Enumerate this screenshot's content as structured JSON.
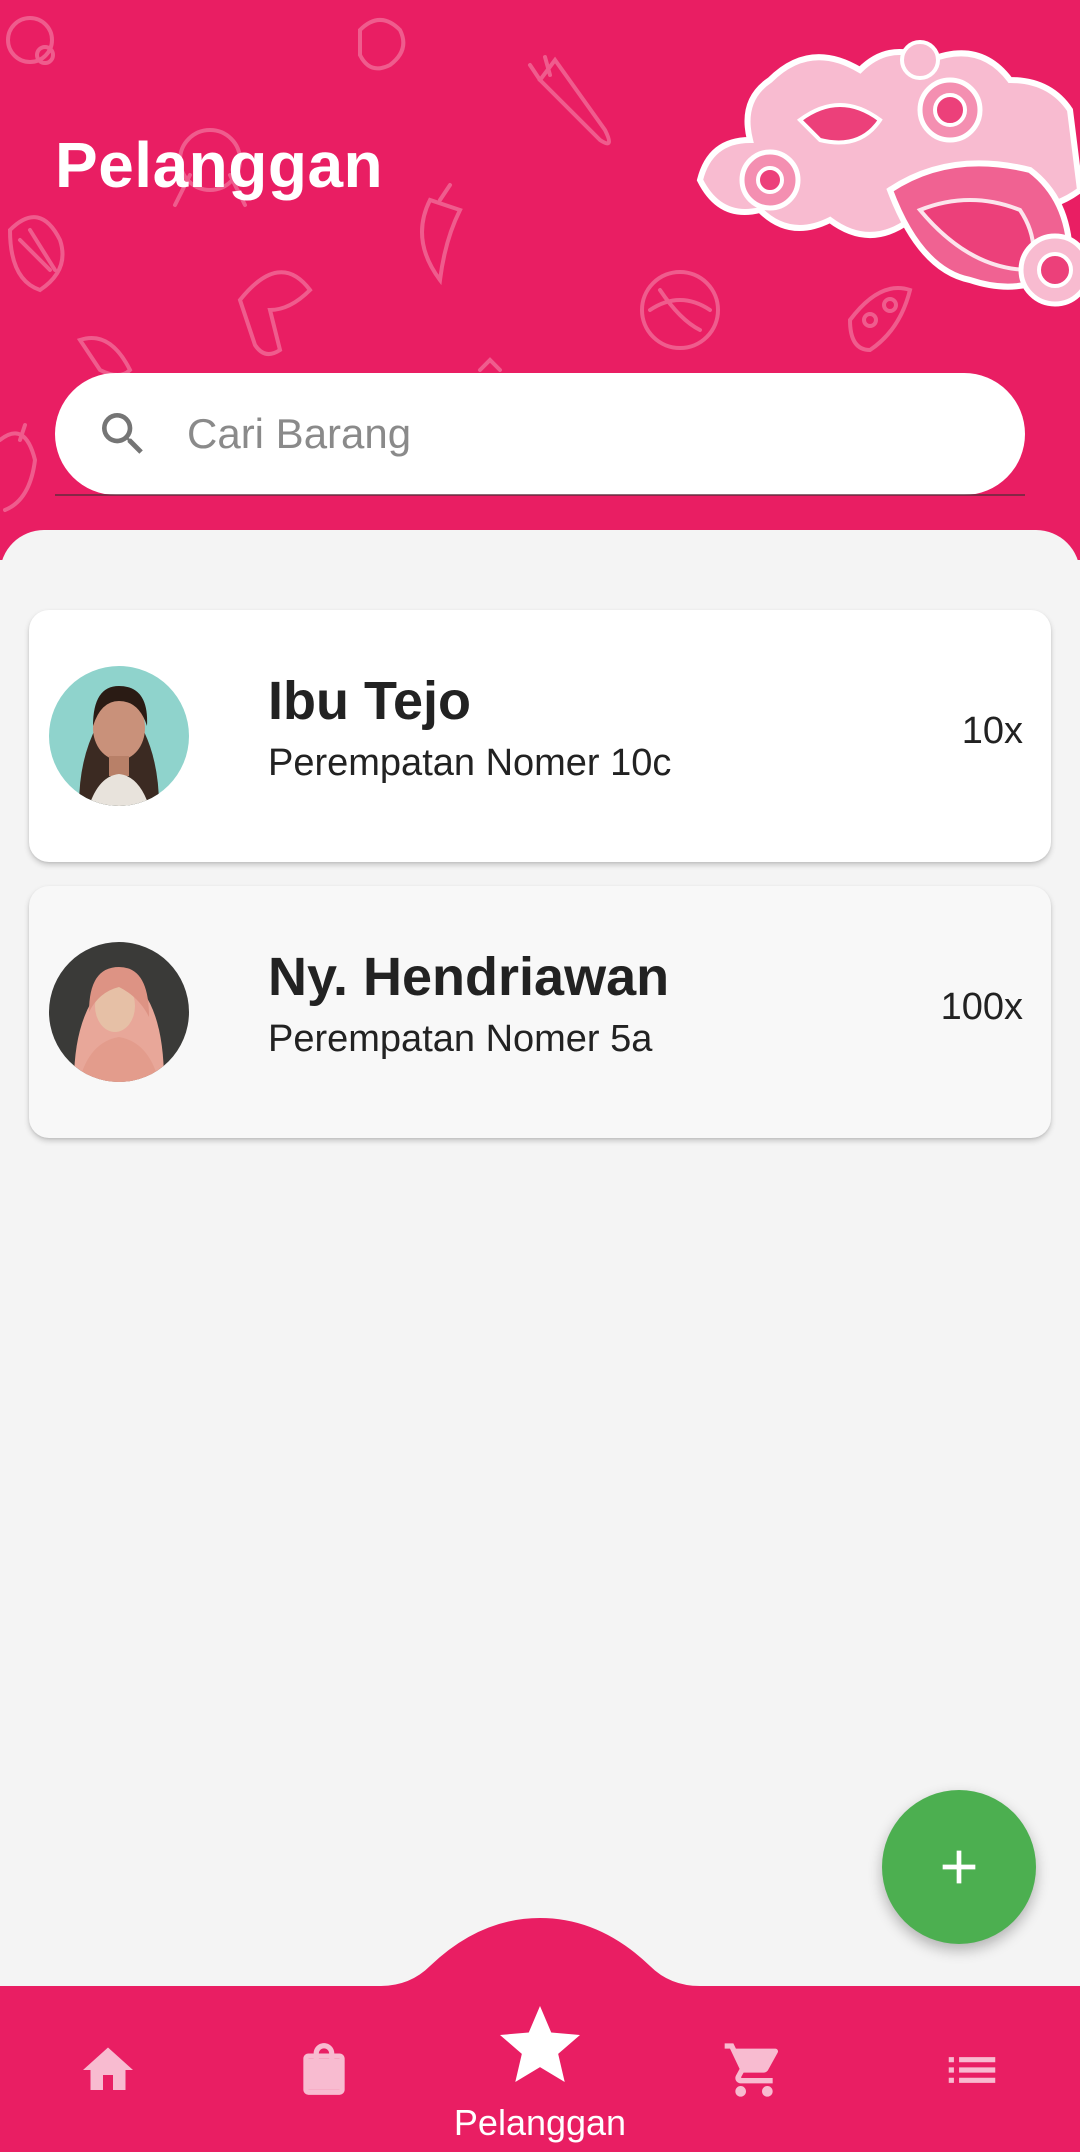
{
  "header": {
    "title": "Pelanggan"
  },
  "search": {
    "placeholder": "Cari Barang",
    "icon": "search-icon"
  },
  "customers": [
    {
      "name": "Ibu Tejo",
      "address": "Perempatan Nomer 10c",
      "count": "10x",
      "avatar": "avatar-photo"
    },
    {
      "name": "Ny. Hendriawan",
      "address": "Perempatan Nomer 5a",
      "count": "100x",
      "avatar": "avatar-photo"
    }
  ],
  "fab": {
    "icon": "plus-icon"
  },
  "bottom_nav": {
    "items": [
      {
        "icon": "home-icon",
        "active": false
      },
      {
        "icon": "shopping-bag-icon",
        "active": false
      },
      {
        "icon": "star-icon",
        "active": true,
        "label": "Pelanggan"
      },
      {
        "icon": "cart-icon",
        "active": false
      },
      {
        "icon": "list-icon",
        "active": false
      }
    ]
  },
  "colors": {
    "primary": "#e91e63",
    "fab": "#4caf50",
    "background": "#f4f4f4",
    "nav_icon_inactive": "#f8bbd0"
  }
}
